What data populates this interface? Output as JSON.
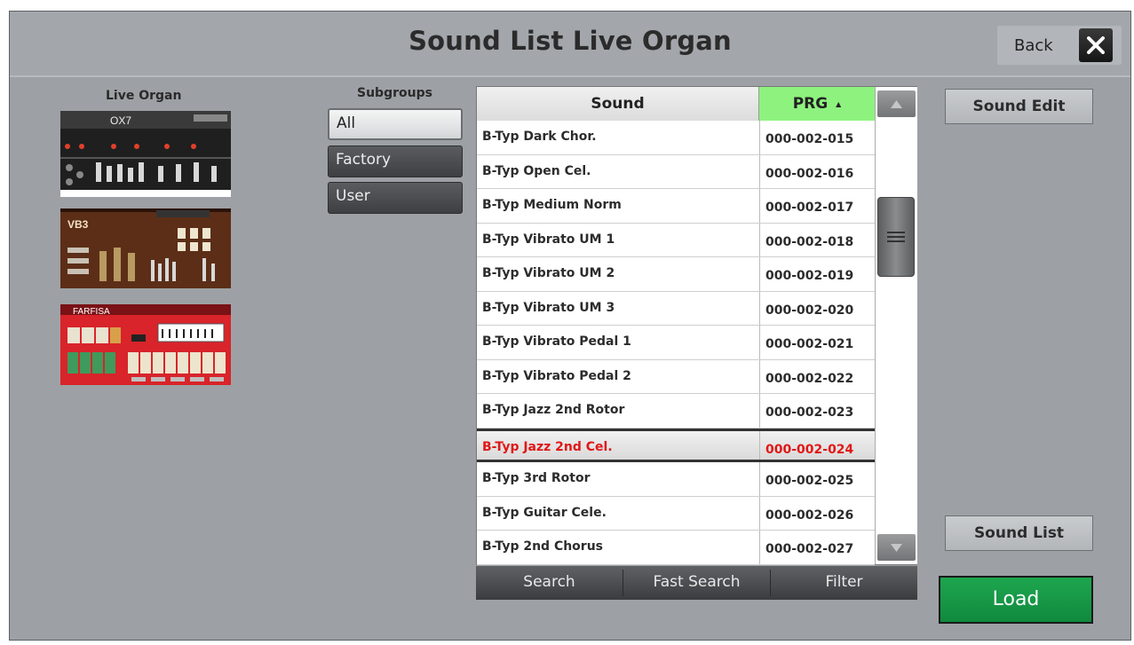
{
  "header": {
    "title": "Sound List Live Organ",
    "back_label": "Back"
  },
  "live_organ": {
    "label": "Live Organ",
    "thumbnails": [
      {
        "name": "OX7",
        "caption": "OX7"
      },
      {
        "name": "VB3",
        "caption": "VB3"
      },
      {
        "name": "Farfisa",
        "caption": "FARFISA"
      }
    ]
  },
  "subgroups": {
    "label": "Subgroups",
    "items": [
      {
        "label": "All",
        "active": true
      },
      {
        "label": "Factory",
        "active": false
      },
      {
        "label": "User",
        "active": false
      }
    ]
  },
  "sound_list": {
    "columns": {
      "sound": "Sound",
      "prg": "PRG",
      "sort_indicator": "▲"
    },
    "rows": [
      {
        "name": "B-Typ Dark Chor.",
        "prg": "000-002-015",
        "selected": false
      },
      {
        "name": "B-Typ Open Cel.",
        "prg": "000-002-016",
        "selected": false
      },
      {
        "name": "B-Typ Medium Norm",
        "prg": "000-002-017",
        "selected": false
      },
      {
        "name": "B-Typ Vibrato UM 1",
        "prg": "000-002-018",
        "selected": false
      },
      {
        "name": "B-Typ Vibrato UM 2",
        "prg": "000-002-019",
        "selected": false
      },
      {
        "name": "B-Typ Vibrato UM 3",
        "prg": "000-002-020",
        "selected": false
      },
      {
        "name": "B-Typ Vibrato Pedal 1",
        "prg": "000-002-021",
        "selected": false
      },
      {
        "name": "B-Typ Vibrato Pedal 2",
        "prg": "000-002-022",
        "selected": false
      },
      {
        "name": "B-Typ Jazz 2nd Rotor",
        "prg": "000-002-023",
        "selected": false
      },
      {
        "name": "B-Typ Jazz 2nd Cel.",
        "prg": "000-002-024",
        "selected": true
      },
      {
        "name": "B-Typ 3rd Rotor",
        "prg": "000-002-025",
        "selected": false
      },
      {
        "name": "B-Typ Guitar Cele.",
        "prg": "000-002-026",
        "selected": false
      },
      {
        "name": "B-Typ 2nd Chorus",
        "prg": "000-002-027",
        "selected": false
      }
    ]
  },
  "bottom_bar": {
    "search": "Search",
    "fast_search": "Fast Search",
    "filter": "Filter"
  },
  "side": {
    "sound_edit": "Sound Edit",
    "sound_list": "Sound List",
    "load": "Load"
  },
  "colors": {
    "prg_header": "#8ef27e",
    "selected_text": "#e01818",
    "load_button": "#1ea64f"
  }
}
